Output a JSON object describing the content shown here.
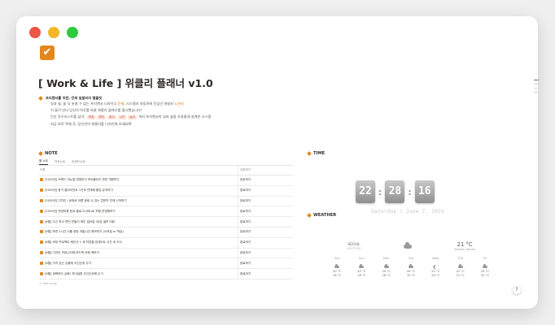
{
  "page": {
    "icon": "check-square-icon",
    "title": "[ Work & Life ] 위클리 플래너 v1.0",
    "accent_color": "#e3871c"
  },
  "intro": {
    "heading": "프리랜서를 위한, 진짜 일잘러의 템플릿",
    "line1_prefix": "일과 삶, 둘 다 놓칠 수 없는 프리랜서 디자이너 ",
    "line1_hl1": "문제",
    "line1_mid": ", 시스템과 자동화에 진심인 개발자 ",
    "line1_hl2": "노션러",
    "line2": "이 둘이 만나 당신의 하루를 바꿀 위클리 플래너를 출시했습니다!",
    "line3_prefix": "단순 투두리스트를 넘어, ",
    "tags": [
      "목표",
      "루틴",
      "회고",
      "시간",
      "날씨"
    ],
    "line3_suffix": " 까지 프리랜서의 일과 삶을 조화롭게 설계한 시스템",
    "line4": "지금 바로 복제 후, 당신만의 위클리를 디자인해 보세요😎"
  },
  "note": {
    "heading": "NOTE",
    "tabs": [
      "할 노트",
      "자유노트",
      "트위드노트"
    ],
    "col_name": "이름",
    "col_status": "유형하기",
    "rows": [
      {
        "name": "[2020년] 브랜드 리뉴얼 방법하고 포트폴리오 반반 개편하기",
        "status": "완료하기"
      },
      {
        "name": "[2020년] 동기 클라이언트 1곳과 연계해 월임 유지하기",
        "status": "완료하기"
      },
      {
        "name": "[2020년] 디자인 / 로와로 이름 등링 수 있는 콘텐츠 연재 시작하기",
        "status": "완료하기"
      },
      {
        "name": "[2020년] 작업비용 표로 클로그(서비)로 적합 운영해보기",
        "status": "완료하기"
      },
      {
        "name": "[6월] 주간 최고 루틴 만들기 매주 일요일 30분 셀프 리뷰",
        "status": "완료하기"
      },
      {
        "name": "[6월] 하루 1시간 나를 위한 개발시간 확보하기 (오후일 or 학습)",
        "status": "완료하기"
      },
      {
        "name": "[6월] 외부 프로젝트 제안서 1 새 작업을 업데이트 시간 네 조사",
        "status": "완료하기"
      },
      {
        "name": "[6월] 디자인 커뮤니티에 피드백 요청 해보기",
        "status": "완료하기"
      },
      {
        "name": "[6월] 가치 있는 상황에 우선순위 두기",
        "status": "완료하기"
      },
      {
        "name": "[6월] 생택보다 실행! 자녀설명 우선순위에 두기",
        "status": "완료하기"
      }
    ],
    "new_page": "+ New page"
  },
  "time": {
    "heading": "TIME",
    "hours": "22",
    "minutes": "28",
    "seconds": "16",
    "date": "Saturday | June 7, 2025"
  },
  "weather": {
    "heading": "WEATHER",
    "city": "SEOUL",
    "city_sub": "WEATHER",
    "current_temp": "21 °C",
    "current_desc": "broken clouds",
    "days": [
      {
        "name": "Sat",
        "icon": "cloud-icon",
        "high": "20 °C",
        "low": "16 °C"
      },
      {
        "name": "Sun",
        "icon": "cloud-icon",
        "high": "20 °C",
        "low": "18 °C"
      },
      {
        "name": "Mon",
        "icon": "cloud-icon",
        "high": "20 °C",
        "low": "18 °C"
      },
      {
        "name": "Tue",
        "icon": "cloud-icon",
        "high": "20 °C",
        "low": "19 °C"
      },
      {
        "name": "Wed",
        "icon": "moon-icon",
        "high": "22 °C",
        "low": "20 °C"
      },
      {
        "name": "Thu",
        "icon": "cloud-icon",
        "high": "22 °C",
        "low": "21 °C"
      },
      {
        "name": "Fri",
        "icon": "cloud-icon",
        "high": "24 °C",
        "low": "22 °C"
      }
    ]
  },
  "help": "?"
}
